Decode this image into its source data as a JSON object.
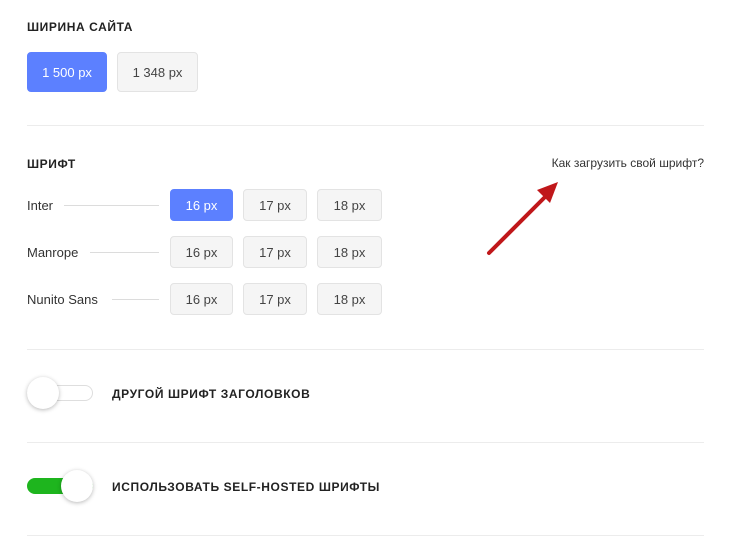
{
  "site_width": {
    "title": "ШИРИНА САЙТА",
    "options": [
      {
        "label": "1 500 px",
        "selected": true
      },
      {
        "label": "1 348 px",
        "selected": false
      }
    ]
  },
  "font": {
    "title": "ШРИФТ",
    "upload_link": "Как загрузить свой шрифт?",
    "families": [
      {
        "name": "Inter",
        "sizes": [
          "16 px",
          "17 px",
          "18 px"
        ],
        "selected_size": "16 px"
      },
      {
        "name": "Manrope",
        "sizes": [
          "16 px",
          "17 px",
          "18 px"
        ],
        "selected_size": null
      },
      {
        "name": "Nunito Sans",
        "sizes": [
          "16 px",
          "17 px",
          "18 px"
        ],
        "selected_size": null
      }
    ]
  },
  "toggles": [
    {
      "label": "ДРУГОЙ ШРИФТ ЗАГОЛОВКОВ",
      "on": false
    },
    {
      "label": "ИСПОЛЬЗОВАТЬ SELF-HOSTED ШРИФТЫ",
      "on": true
    }
  ],
  "colors": {
    "accent": "#5c80ff",
    "toggle_on": "#1eb51e",
    "annotation_arrow": "#c0171a"
  },
  "annotation": {
    "icon": "red-arrow-icon"
  }
}
